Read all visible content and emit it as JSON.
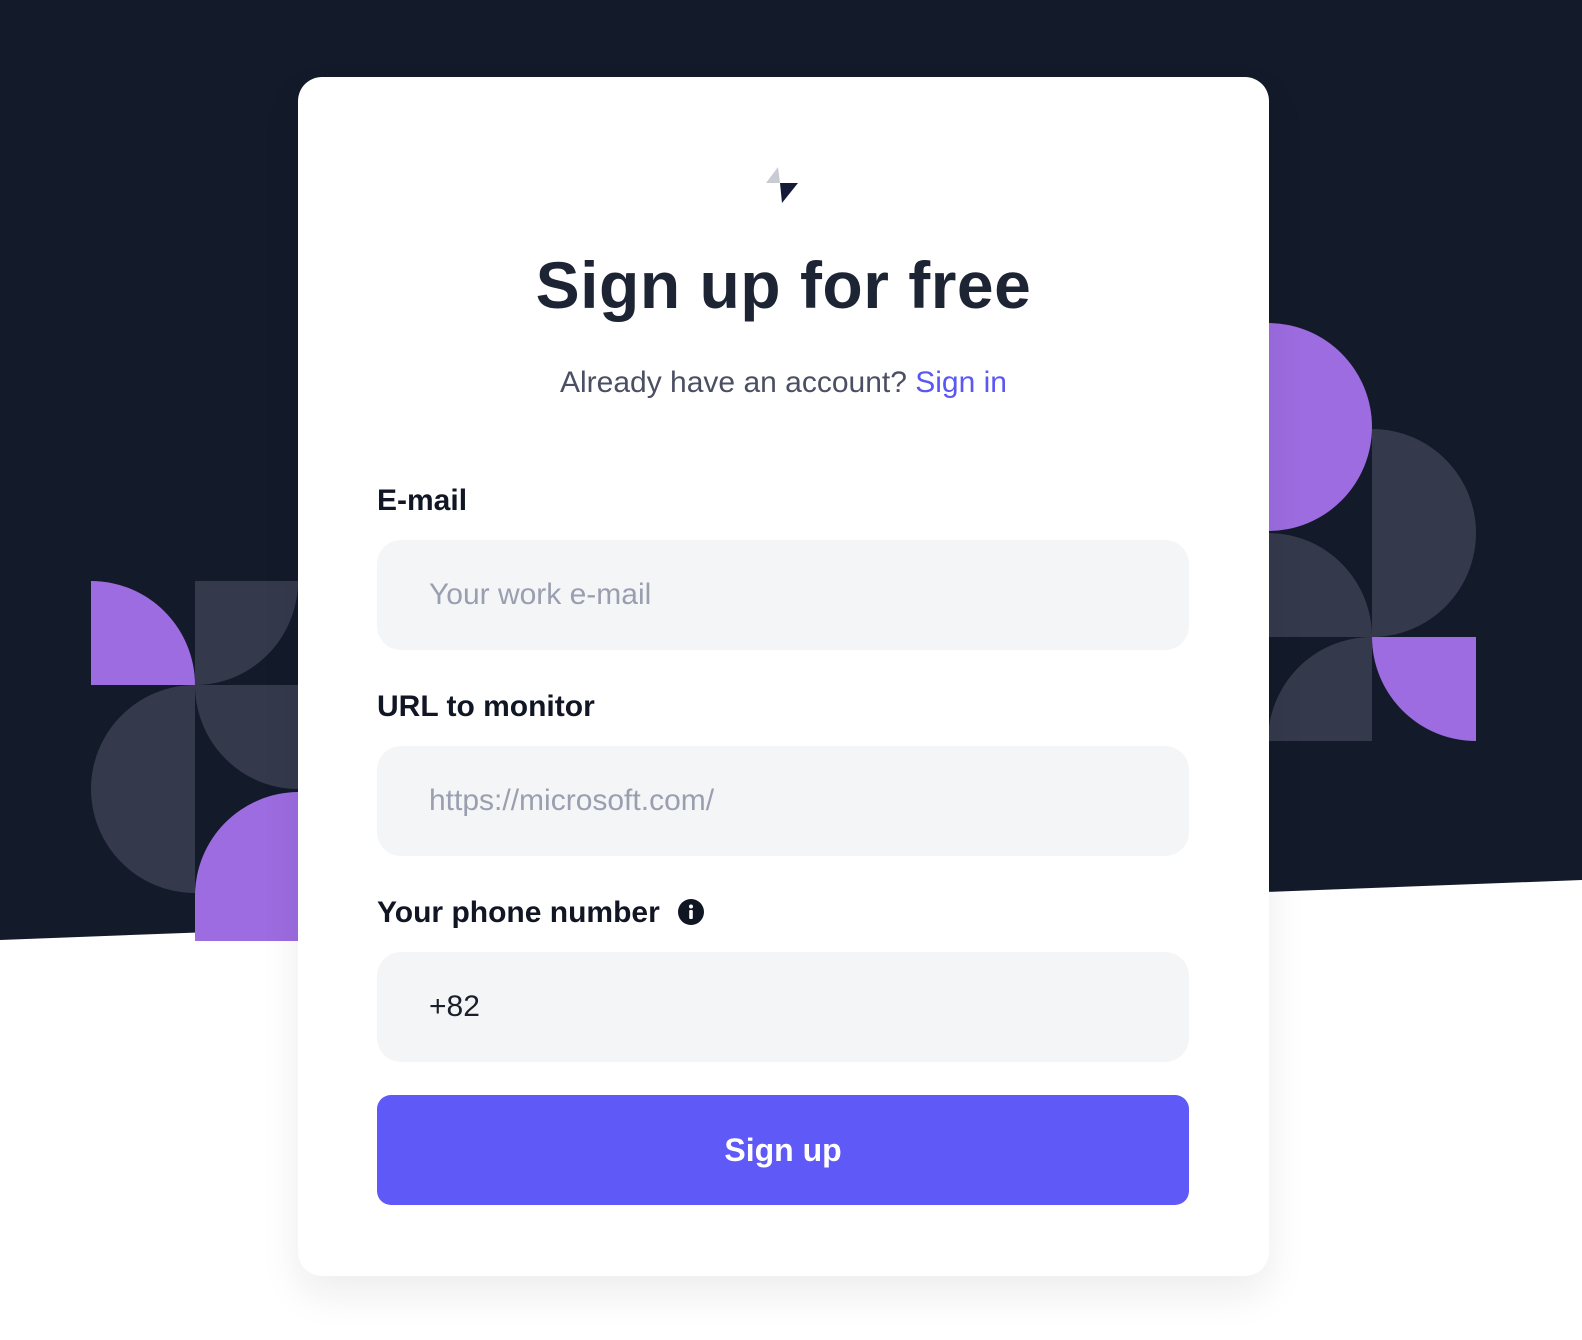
{
  "page": {
    "title": "Sign up for free",
    "prompt_text": "Already have an account?",
    "signin_link": "Sign in"
  },
  "form": {
    "email": {
      "label": "E-mail",
      "placeholder": "Your work e-mail",
      "value": ""
    },
    "url": {
      "label": "URL to monitor",
      "placeholder": "https://microsoft.com/",
      "value": ""
    },
    "phone": {
      "label": "Your phone number",
      "value": "+82",
      "info_icon": "info-icon"
    },
    "submit_label": "Sign up"
  },
  "colors": {
    "background_dark": "#131a2a",
    "accent": "#5f59f7",
    "link": "#5b57f5",
    "deco_purple": "#9d6ce0",
    "deco_slate": "#343a4c",
    "input_bg": "#f4f5f7"
  },
  "icons": {
    "logo": "bolt-logo-icon",
    "info": "info-icon"
  }
}
